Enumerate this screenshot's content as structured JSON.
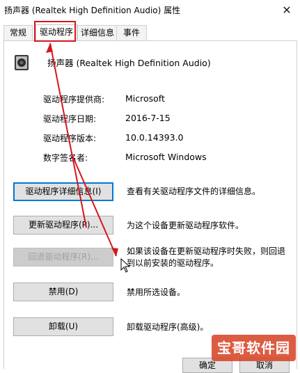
{
  "window": {
    "title": "扬声器 (Realtek High Definition Audio) 属性",
    "close_glyph": "✕"
  },
  "tabs": [
    {
      "label": "常规"
    },
    {
      "label": "驱动程序"
    },
    {
      "label": "详细信息"
    },
    {
      "label": "事件"
    }
  ],
  "device": {
    "name": "扬声器 (Realtek High Definition Audio)",
    "icon": "speaker-icon"
  },
  "info": [
    {
      "label": "驱动程序提供商:",
      "value": "Microsoft"
    },
    {
      "label": "驱动程序日期:",
      "value": "2016-7-15"
    },
    {
      "label": "驱动程序版本:",
      "value": "10.0.14393.0"
    },
    {
      "label": "数字签名者:",
      "value": "Microsoft Windows"
    }
  ],
  "actions": [
    {
      "button": "驱动程序详细信息(I)",
      "description": "查看有关驱动程序文件的详细信息。"
    },
    {
      "button": "更新驱动程序(P)...",
      "description": "为这个设备更新驱动程序软件。"
    },
    {
      "button": "回退驱动程序(R)...",
      "description": "如果该设备在更新驱动程序时失败，则回退到以前安装的驱动程序。"
    },
    {
      "button": "禁用(D)",
      "description": "禁用所选设备。"
    },
    {
      "button": "卸载(U)",
      "description": "卸载驱动程序(高级)。"
    }
  ],
  "footer": {
    "ok": "确定",
    "cancel": "取消"
  },
  "watermark": {
    "text": "宝哥软件园"
  },
  "colors": {
    "annotation_red": "#d5161d",
    "focus_blue": "#0078d7"
  }
}
